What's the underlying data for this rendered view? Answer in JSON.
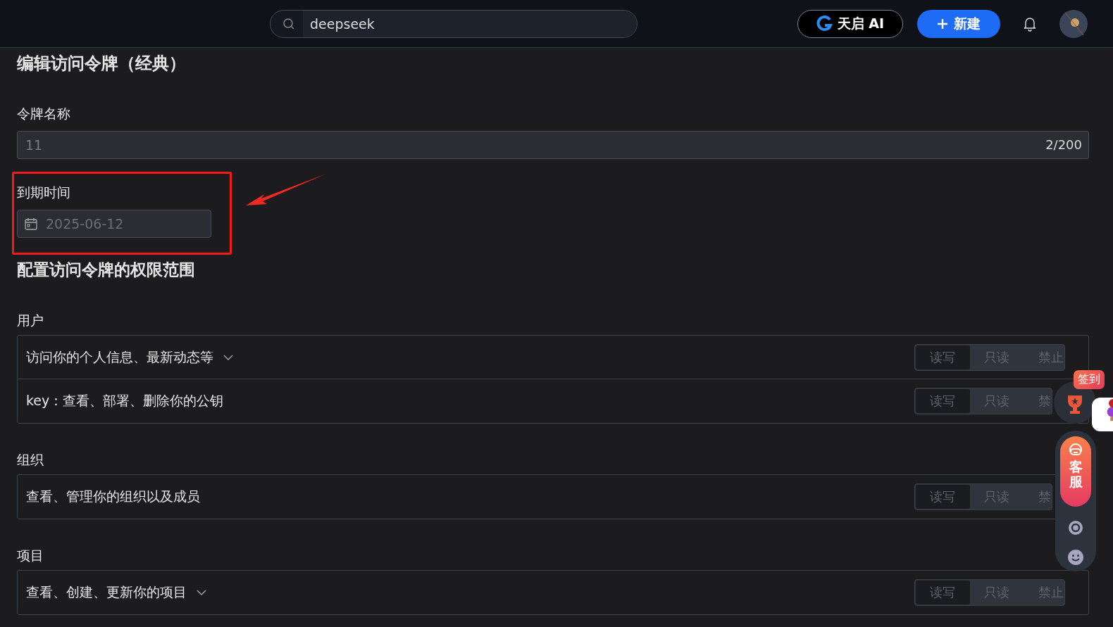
{
  "search": {
    "value": "deepseek"
  },
  "header": {
    "brand": "天启 AI",
    "new_button": "新建"
  },
  "title": "编辑访问令牌（经典）",
  "name_field": {
    "label": "令牌名称",
    "value": "11",
    "counter": "2/200"
  },
  "expiry_field": {
    "label": "到期时间",
    "placeholder": "2025-06-12",
    "highlighted": true
  },
  "scope_title": "配置访问令牌的权限范围",
  "groups": [
    {
      "label": "用户",
      "rows": [
        {
          "text": "访问你的个人信息、最新动态等",
          "expandable": true,
          "options": [
            {
              "label": "读写",
              "selected": true
            },
            {
              "label": "只读",
              "selected": false
            },
            {
              "label": "禁止",
              "selected": false
            }
          ]
        },
        {
          "text": "key：查看、部署、删除你的公钥",
          "expandable": false,
          "options": [
            {
              "label": "读写",
              "selected": true
            },
            {
              "label": "只读",
              "selected": false
            },
            {
              "label": "禁",
              "selected": false
            }
          ]
        }
      ]
    },
    {
      "label": "组织",
      "rows": [
        {
          "text": "查看、管理你的组织以及成员",
          "expandable": false,
          "options": [
            {
              "label": "读写",
              "selected": true
            },
            {
              "label": "只读",
              "selected": false
            },
            {
              "label": "禁",
              "selected": false
            }
          ]
        }
      ]
    },
    {
      "label": "项目",
      "rows": [
        {
          "text": "查看、创建、更新你的项目",
          "expandable": true,
          "options": [
            {
              "label": "读写",
              "selected": true
            },
            {
              "label": "只读",
              "selected": false
            },
            {
              "label": "禁止",
              "selected": false
            }
          ]
        }
      ]
    }
  ],
  "float": {
    "checkin": "签到",
    "service": "客服"
  }
}
